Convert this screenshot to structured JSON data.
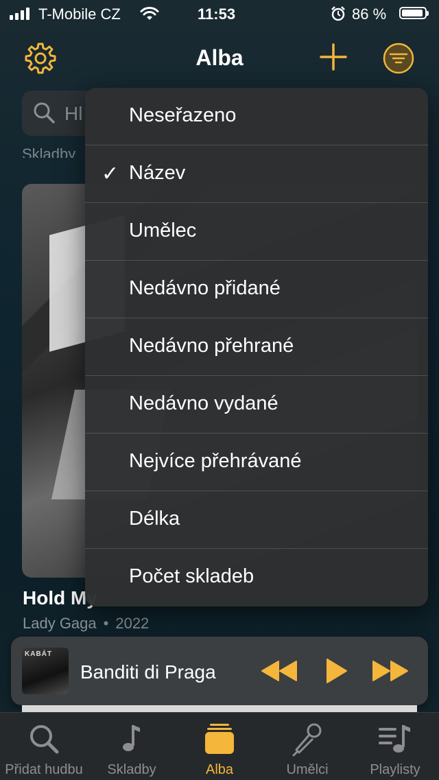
{
  "status_bar": {
    "carrier": "T-Mobile CZ",
    "time": "11:53",
    "battery_percent": "86 %"
  },
  "nav": {
    "title": "Alba",
    "search_placeholder_visible": "Hl",
    "scroll_hint": "Skladby"
  },
  "colors": {
    "accent": "#f4b63b",
    "menu_bg": "#2e3032",
    "tab_inactive": "#8e8e92"
  },
  "sort_menu": {
    "items": [
      {
        "label": "Neseřazeno",
        "checked": false
      },
      {
        "label": "Název",
        "checked": true
      },
      {
        "label": "Umělec",
        "checked": false
      },
      {
        "label": "Nedávno přidané",
        "checked": false
      },
      {
        "label": "Nedávno přehrané",
        "checked": false
      },
      {
        "label": "Nedávno vydané",
        "checked": false
      },
      {
        "label": "Nejvíce přehrávané",
        "checked": false
      },
      {
        "label": "Délka",
        "checked": false
      },
      {
        "label": "Počet skladeb",
        "checked": false
      }
    ],
    "check_glyph": "✓"
  },
  "album": {
    "title": "Hold My",
    "artist": "Lady Gaga",
    "separator": "•",
    "year": "2022"
  },
  "player": {
    "song": "Banditi di Praga",
    "art_text": "KABÁT"
  },
  "tabs": [
    {
      "label": "Přidat hudbu",
      "icon": "search-icon",
      "active": false
    },
    {
      "label": "Skladby",
      "icon": "music-note-icon",
      "active": false
    },
    {
      "label": "Alba",
      "icon": "album-stack-icon",
      "active": true
    },
    {
      "label": "Umělci",
      "icon": "microphone-icon",
      "active": false
    },
    {
      "label": "Playlisty",
      "icon": "playlist-icon",
      "active": false
    }
  ]
}
